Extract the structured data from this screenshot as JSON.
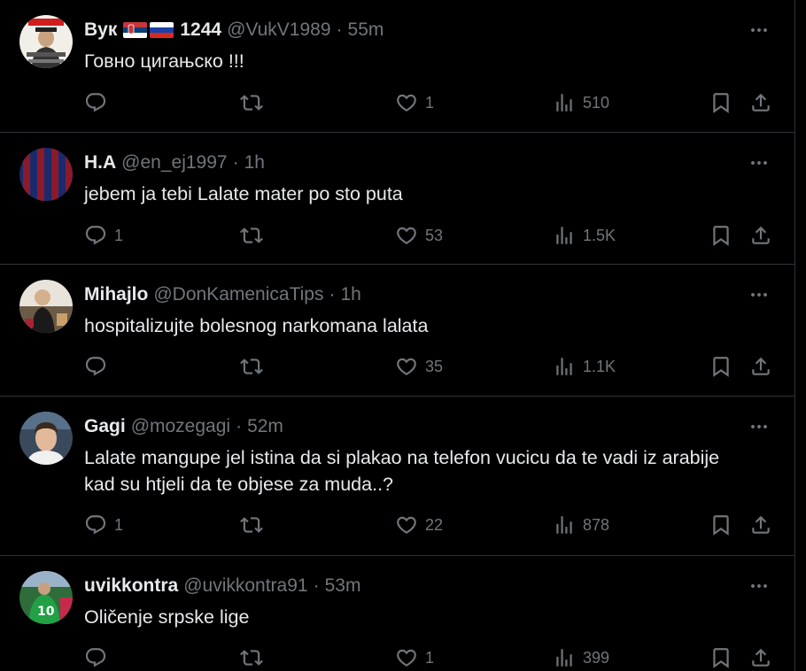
{
  "tweets": [
    {
      "name": "Вук",
      "flags": [
        "serbia-flag",
        "russia-flag"
      ],
      "name_suffix": "1244",
      "handle": "@VukV1989",
      "time": "55m",
      "text": "Говно цигањско !!!",
      "replies": "",
      "likes": "1",
      "views": "510"
    },
    {
      "name": "H.A",
      "handle": "@en_ej1997",
      "time": "1h",
      "text": "jebem ja tebi Lalate mater po sto puta",
      "replies": "1",
      "likes": "53",
      "views": "1.5K"
    },
    {
      "name": "Mihajlo",
      "handle": "@DonKamenicaTips",
      "time": "1h",
      "text": "hospitalizujte bolesnog narkomana lalata",
      "replies": "",
      "likes": "35",
      "views": "1.1K"
    },
    {
      "name": "Gagi",
      "handle": "@mozegagi",
      "time": "52m",
      "text_line1": "Lalate mangupe jel istina da si plakao na telefon vucicu da te vadi iz arabije",
      "text_line2": "kad su htjeli da te objese za muda..?",
      "replies": "1",
      "likes": "22",
      "views": "878"
    },
    {
      "name": "uvikkontra",
      "handle": "@uvikkontra91",
      "time": "53m",
      "text": "Oličenje srpske lige",
      "replies": "",
      "likes": "1",
      "views": "399"
    }
  ],
  "separator": "·",
  "icons": [
    "reply-icon",
    "retweet-icon",
    "like-icon",
    "views-icon",
    "bookmark-icon",
    "share-icon",
    "more-icon"
  ]
}
